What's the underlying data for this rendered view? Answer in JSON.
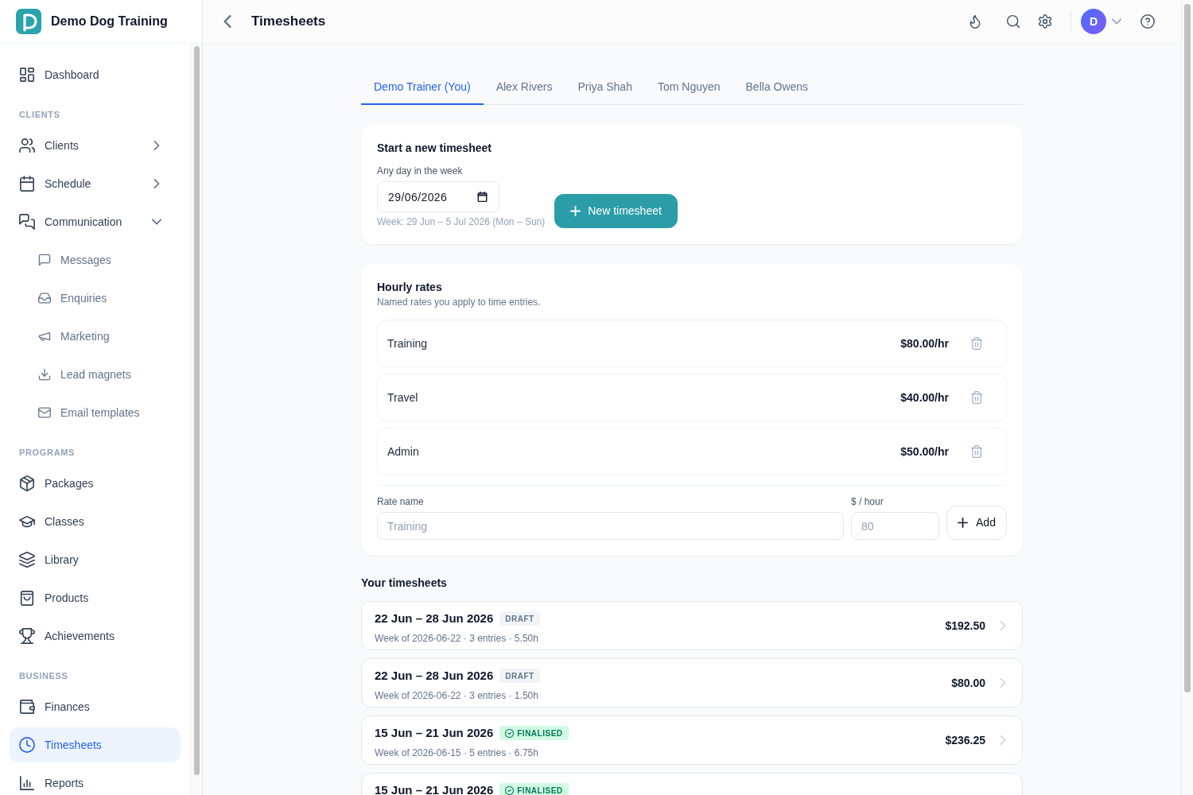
{
  "app": {
    "name": "Demo Dog Training"
  },
  "sidebar": {
    "items": [
      {
        "kind": "link",
        "label": "Dashboard",
        "selected": false
      },
      {
        "kind": "heading",
        "label": "CLIENTS"
      },
      {
        "kind": "link",
        "label": "Clients",
        "selected": false,
        "expanded": false
      },
      {
        "kind": "link",
        "label": "Schedule",
        "selected": false,
        "expanded": false
      },
      {
        "kind": "link",
        "label": "Communication",
        "selected": false,
        "expanded": true,
        "children": [
          {
            "label": "Messages",
            "selected": false
          },
          {
            "label": "Enquiries",
            "selected": false
          },
          {
            "label": "Marketing",
            "selected": false
          },
          {
            "label": "Lead magnets",
            "selected": false
          },
          {
            "label": "Email templates",
            "selected": false
          }
        ]
      },
      {
        "kind": "heading",
        "label": "PROGRAMS"
      },
      {
        "kind": "link",
        "label": "Packages",
        "selected": false
      },
      {
        "kind": "link",
        "label": "Classes",
        "selected": false
      },
      {
        "kind": "link",
        "label": "Library",
        "selected": false
      },
      {
        "kind": "link",
        "label": "Products",
        "selected": false
      },
      {
        "kind": "link",
        "label": "Achievements",
        "selected": false
      },
      {
        "kind": "heading",
        "label": "BUSINESS"
      },
      {
        "kind": "link",
        "label": "Finances",
        "selected": false
      },
      {
        "kind": "link",
        "label": "Timesheets",
        "selected": true
      },
      {
        "kind": "link",
        "label": "Reports",
        "selected": false
      }
    ]
  },
  "header": {
    "title": "Timesheets",
    "avatar_initial": "D"
  },
  "tabs": [
    {
      "label": "Demo Trainer (You)",
      "selected": true
    },
    {
      "label": "Alex Rivers",
      "selected": false
    },
    {
      "label": "Priya Shah",
      "selected": false
    },
    {
      "label": "Tom Nguyen",
      "selected": false
    },
    {
      "label": "Bella Owens",
      "selected": false
    }
  ],
  "new_timesheet": {
    "title": "Start a new timesheet",
    "date_label": "Any day in the week",
    "date_value": "29/06/2026",
    "week_hint": "Week: 29 Jun – 5 Jul 2026 (Mon – Sun)",
    "button": "New timesheet"
  },
  "hourly_rates": {
    "title": "Hourly rates",
    "subtitle": "Named rates you apply to time entries.",
    "rates": [
      {
        "name": "Training",
        "amount": "$80.00/hr"
      },
      {
        "name": "Travel",
        "amount": "$40.00/hr"
      },
      {
        "name": "Admin",
        "amount": "$50.00/hr"
      }
    ],
    "form": {
      "name_label": "Rate name",
      "name_placeholder": "Training",
      "rate_label": "$ / hour",
      "rate_placeholder": "80",
      "button": "Add"
    }
  },
  "timesheets": {
    "title": "Your timesheets",
    "items": [
      {
        "title": "22 Jun – 28 Jun 2026",
        "status": {
          "kind": "draft",
          "label": "DRAFT"
        },
        "summary": "Week of 2026-06-22 · 3 entries · 5.50h",
        "total": "$192.50"
      },
      {
        "title": "22 Jun – 28 Jun 2026",
        "status": {
          "kind": "draft",
          "label": "DRAFT"
        },
        "summary": "Week of 2026-06-22 · 3 entries · 1.50h",
        "total": "$80.00"
      },
      {
        "title": "15 Jun – 21 Jun 2026",
        "status": {
          "kind": "finalised",
          "label": "FINALISED"
        },
        "summary": "Week of 2026-06-15 · 5 entries · 6.75h",
        "total": "$236.25"
      },
      {
        "title": "15 Jun – 21 Jun 2026",
        "status": {
          "kind": "finalised",
          "label": "FINALISED"
        }
      }
    ]
  }
}
